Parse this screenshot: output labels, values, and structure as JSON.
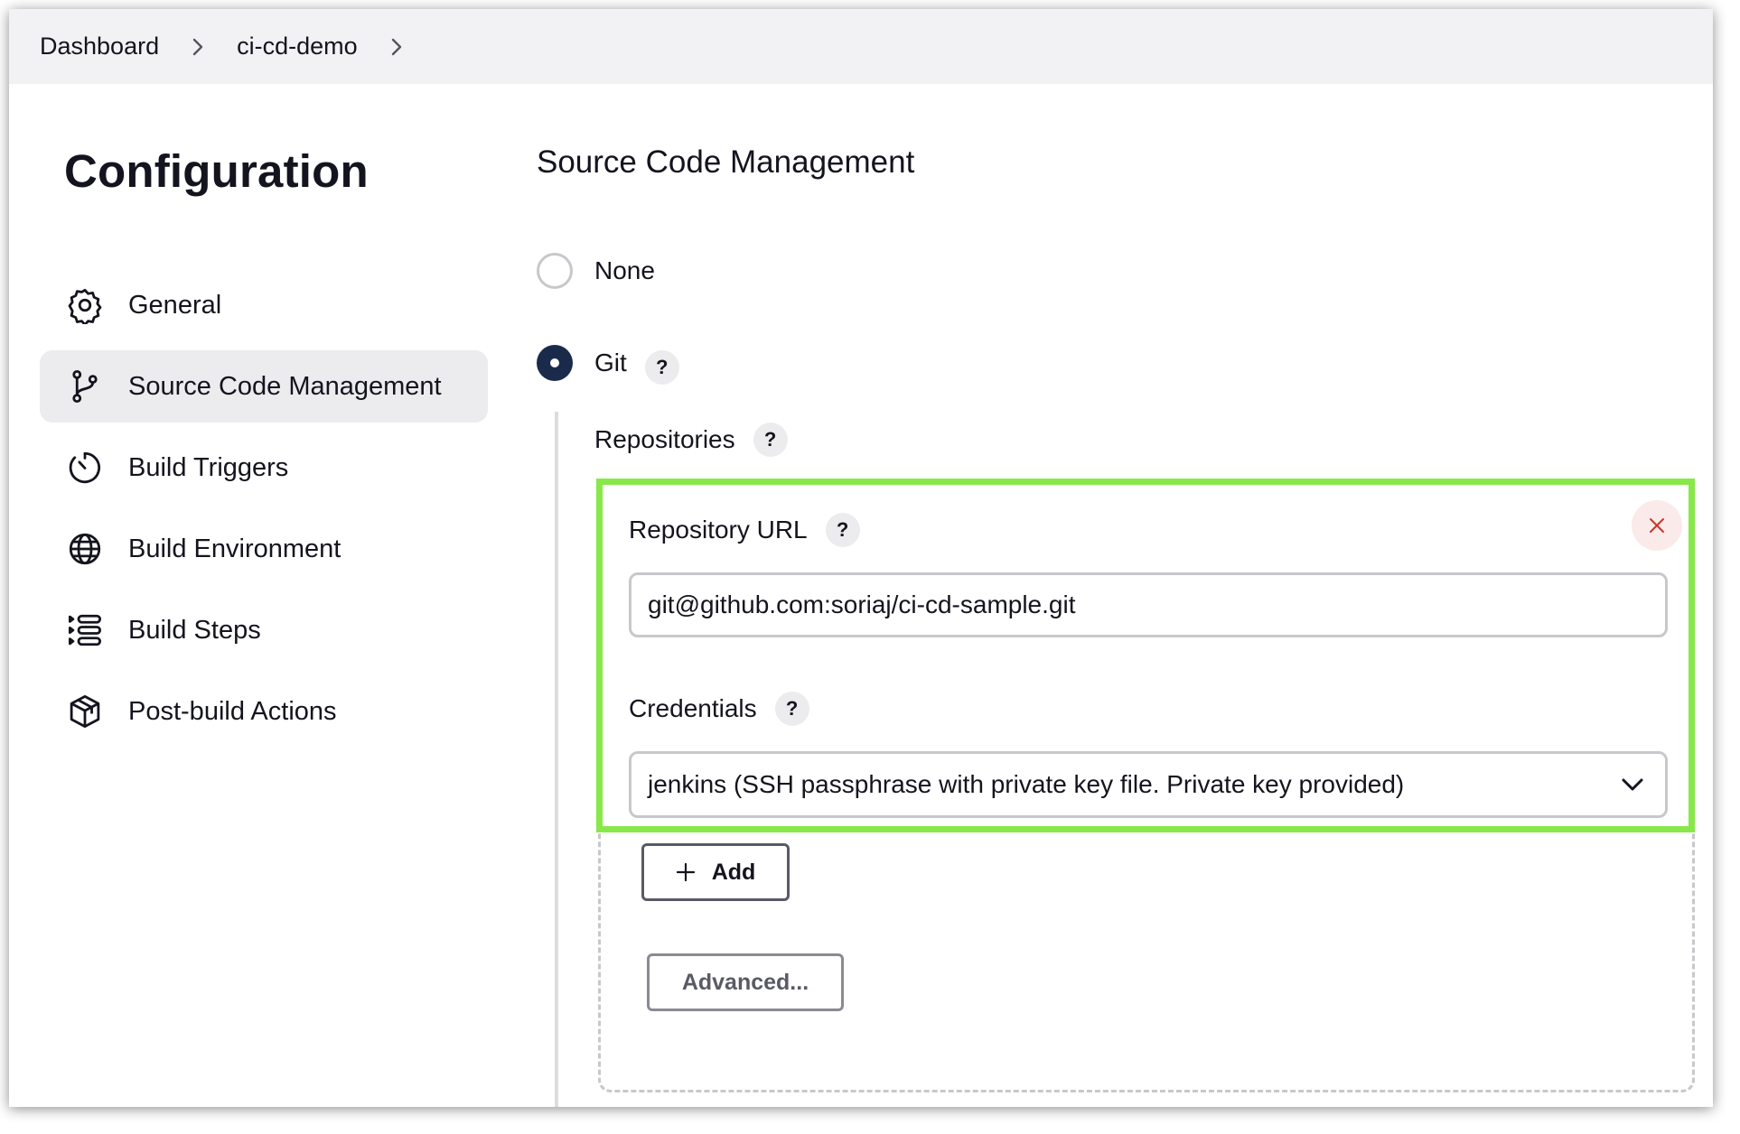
{
  "breadcrumb": {
    "items": [
      "Dashboard",
      "ci-cd-demo"
    ]
  },
  "sidebar": {
    "title": "Configuration",
    "items": [
      {
        "label": "General",
        "icon": "gear-icon"
      },
      {
        "label": "Source Code Management",
        "icon": "git-branch-icon",
        "active": true
      },
      {
        "label": "Build Triggers",
        "icon": "timer-icon"
      },
      {
        "label": "Build Environment",
        "icon": "globe-icon"
      },
      {
        "label": "Build Steps",
        "icon": "list-icon"
      },
      {
        "label": "Post-build Actions",
        "icon": "package-icon"
      }
    ]
  },
  "main": {
    "section_title": "Source Code Management",
    "scm_options": [
      {
        "label": "None",
        "selected": false
      },
      {
        "label": "Git",
        "selected": true
      }
    ],
    "help_glyph": "?",
    "repositories_label": "Repositories",
    "repository_url_label": "Repository URL",
    "repository_url_value": "git@github.com:soriaj/ci-cd-sample.git",
    "credentials_label": "Credentials",
    "credentials_value": "jenkins (SSH passphrase with private key file. Private key provided)",
    "add_button": "Add",
    "advanced_button": "Advanced..."
  },
  "colors": {
    "highlight": "#88e84a",
    "radio_checked": "#1a2a4a",
    "close_icon": "#c0392b"
  }
}
